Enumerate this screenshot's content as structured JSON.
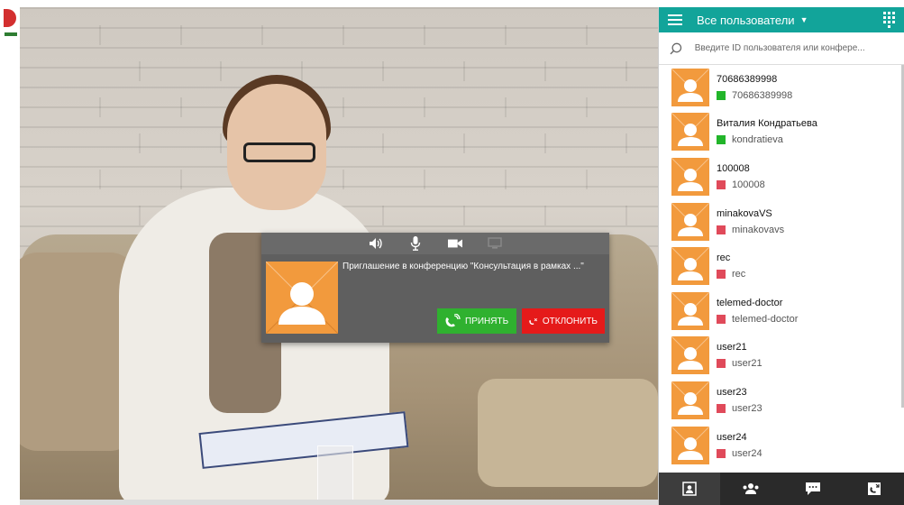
{
  "sidebar": {
    "title": "Все пользователи",
    "search_placeholder": "Введите ID пользователя или конфере...",
    "users": [
      {
        "name": "70686389998",
        "login": "70686389998",
        "status": "online"
      },
      {
        "name": "Виталия Кондратьева",
        "login": "kondratieva",
        "status": "online"
      },
      {
        "name": "100008",
        "login": "100008",
        "status": "offline"
      },
      {
        "name": "minakovaVS",
        "login": "minakovavs",
        "status": "offline"
      },
      {
        "name": "rec",
        "login": "rec",
        "status": "offline"
      },
      {
        "name": "telemed-doctor",
        "login": "telemed-doctor",
        "status": "offline"
      },
      {
        "name": "user21",
        "login": "user21",
        "status": "offline"
      },
      {
        "name": "user23",
        "login": "user23",
        "status": "offline"
      },
      {
        "name": "user24",
        "login": "user24",
        "status": "offline"
      }
    ],
    "bottom_tabs": [
      "contacts-icon",
      "group-icon",
      "chat-icon",
      "call-log-icon"
    ]
  },
  "call": {
    "invite_text": "Приглашение в конференцию \"Консультация в рамках ...\"",
    "accept_label": "ПРИНЯТЬ",
    "decline_label": "ОТКЛОНИТЬ"
  },
  "colors": {
    "header": "#12a49a",
    "avatar": "#f29a3d",
    "online": "#22b52a",
    "offline": "#e04a5a",
    "accept": "#2fb12f",
    "decline": "#e51a1a"
  }
}
